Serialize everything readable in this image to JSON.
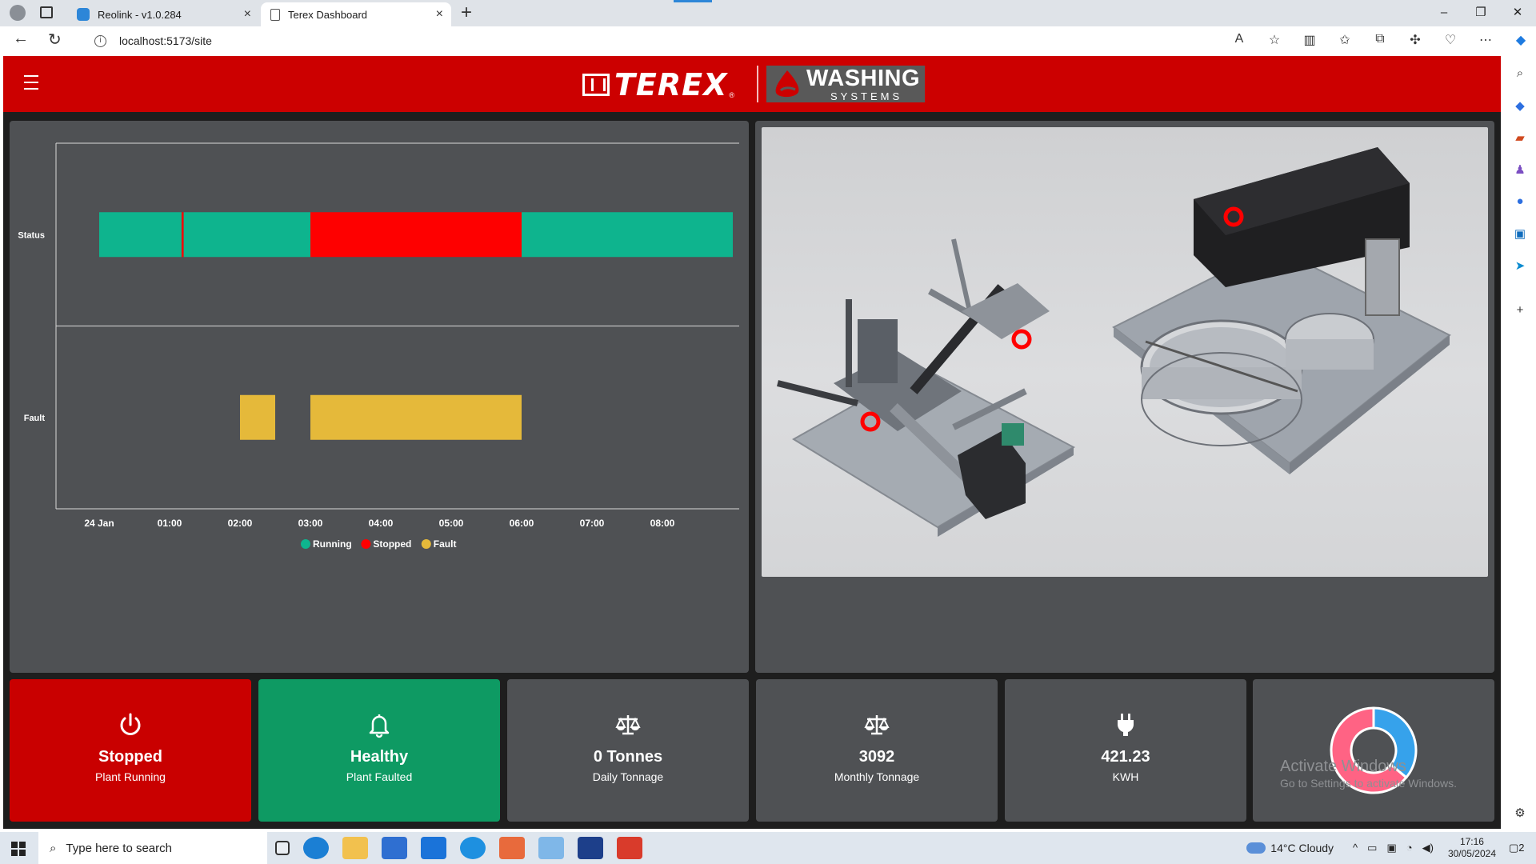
{
  "browser": {
    "tabs": [
      {
        "label": "Reolink - v1.0.284"
      },
      {
        "label": "Terex Dashboard"
      }
    ],
    "url": "localhost:5173/site"
  },
  "header": {
    "brand": "TEREX",
    "brand_reg": "®",
    "sub_brand_line1": "WASHING",
    "sub_brand_line2": "SYSTEMS"
  },
  "chart_data": {
    "type": "timeline",
    "rows": [
      "Status",
      "Fault"
    ],
    "x_ticks": [
      "24 Jan",
      "01:00",
      "02:00",
      "03:00",
      "04:00",
      "05:00",
      "06:00",
      "07:00",
      "08:00"
    ],
    "xlim": [
      0,
      9
    ],
    "legend": [
      {
        "name": "Running",
        "color": "#0eb48e"
      },
      {
        "name": "Stopped",
        "color": "#fe0000"
      },
      {
        "name": "Fault",
        "color": "#e5b93a"
      }
    ],
    "legend_position": "bottom",
    "segments": [
      {
        "row": "Status",
        "state": "Running",
        "start": 0.0,
        "end": 1.17
      },
      {
        "row": "Status",
        "state": "Stopped",
        "start": 1.17,
        "end": 1.2
      },
      {
        "row": "Status",
        "state": "Running",
        "start": 1.2,
        "end": 3.0
      },
      {
        "row": "Status",
        "state": "Stopped",
        "start": 3.0,
        "end": 6.0
      },
      {
        "row": "Status",
        "state": "Running",
        "start": 6.0,
        "end": 9.0
      },
      {
        "row": "Fault",
        "state": "Fault",
        "start": 2.0,
        "end": 2.5
      },
      {
        "row": "Fault",
        "state": "Fault",
        "start": 3.0,
        "end": 6.0
      }
    ]
  },
  "cards": [
    {
      "icon": "power-icon",
      "value": "Stopped",
      "label": "Plant Running",
      "color": "#c90000"
    },
    {
      "icon": "bell-icon",
      "value": "Healthy",
      "label": "Plant Faulted",
      "color": "#0e9a63"
    },
    {
      "icon": "scale-icon",
      "value": "0 Tonnes",
      "label": "Daily Tonnage"
    },
    {
      "icon": "scale-icon",
      "value": "3092",
      "label": "Monthly Tonnage"
    },
    {
      "icon": "plug-icon",
      "value": "421.23",
      "label": "KWH"
    }
  ],
  "donut": {
    "slices": [
      {
        "value": 0.36,
        "color": "#36a2eb"
      },
      {
        "value": 0.64,
        "color": "#ff6384"
      }
    ]
  },
  "watermark": {
    "line1": "Activate Windows",
    "line2": "Go to Settings to activate Windows."
  },
  "taskbar": {
    "search_placeholder": "Type here to search",
    "weather": "14°C  Cloudy",
    "time": "17:16",
    "date": "30/05/2024",
    "notifications": "2"
  }
}
